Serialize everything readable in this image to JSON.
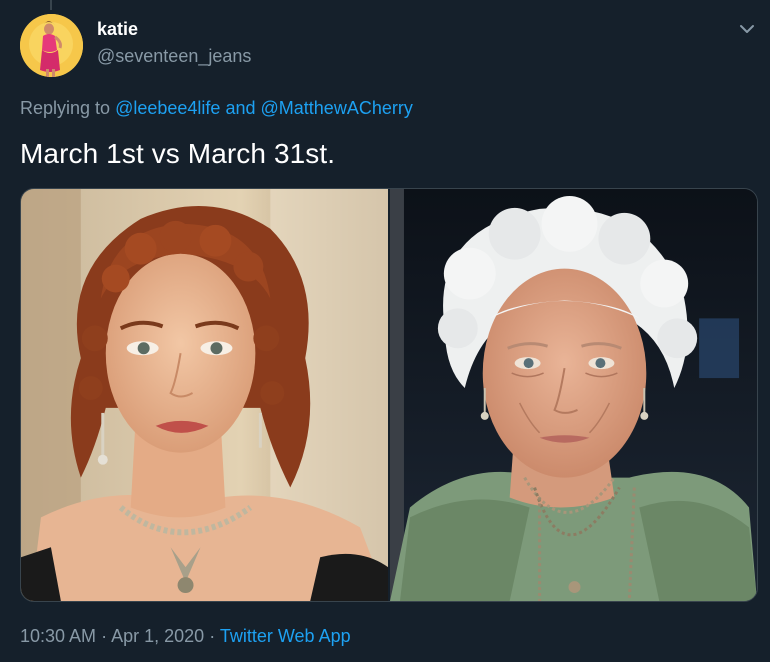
{
  "user": {
    "display_name": "katie",
    "handle": "@seventeen_jeans"
  },
  "reply": {
    "prefix": "Replying to",
    "mention_1": "@leebee4life",
    "conjunction": "and",
    "mention_2": "@MatthewACherry"
  },
  "tweet": {
    "text": "March 1st vs March 31st."
  },
  "meta": {
    "time": "10:30 AM",
    "separator_1": "·",
    "date": "Apr 1, 2020",
    "separator_2": "·",
    "source": "Twitter Web App"
  },
  "icons": {
    "menu": "chevron-down-icon"
  },
  "colors": {
    "background": "#15202b",
    "link": "#1da1f2",
    "secondary_text": "#8899a6",
    "border": "#38444d"
  }
}
